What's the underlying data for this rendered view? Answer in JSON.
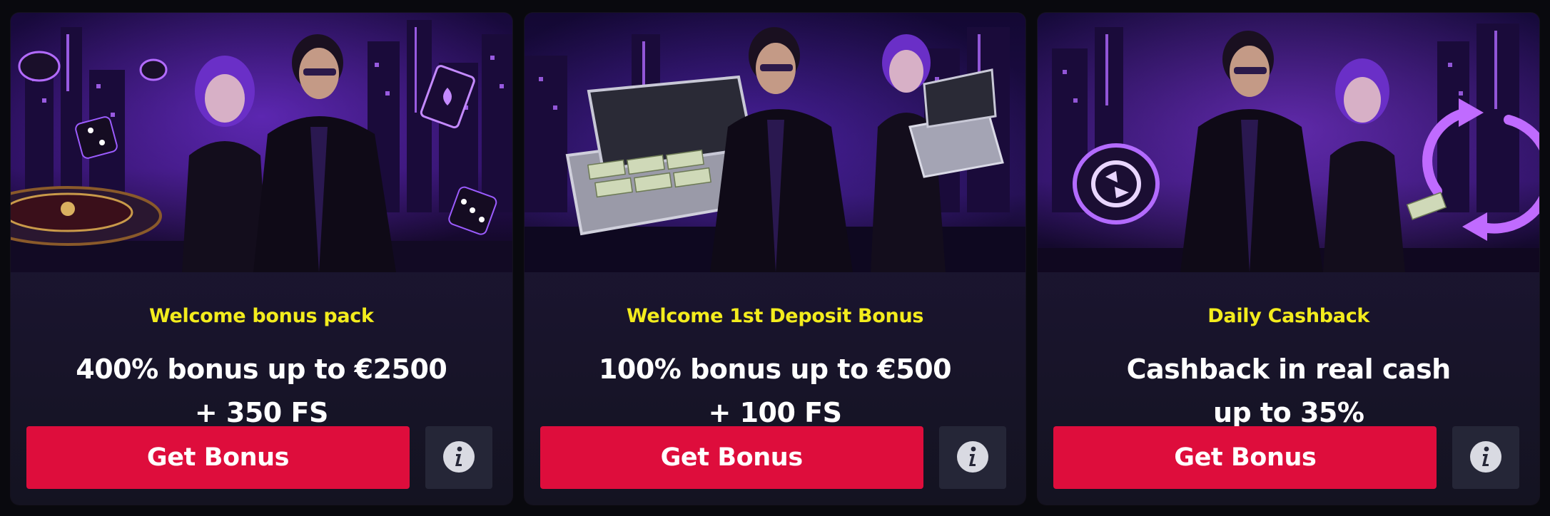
{
  "cards": [
    {
      "title": "Welcome bonus pack",
      "headline": [
        "400% bonus up to €2500",
        "+ 350 FS"
      ],
      "cta_label": "Get Bonus",
      "info_icon": "info-icon",
      "art": "casino-couple-dice-roulette"
    },
    {
      "title": "Welcome 1st Deposit Bonus",
      "headline": [
        "100% bonus up to €500",
        "+ 100 FS"
      ],
      "cta_label": "Get Bonus",
      "info_icon": "info-icon",
      "art": "money-briefcase-couple"
    },
    {
      "title": "Daily Cashback",
      "headline": [
        "Cashback in real cash",
        "up to 35%"
      ],
      "cta_label": "Get Bonus",
      "info_icon": "info-icon",
      "art": "cashback-chip-couple"
    }
  ],
  "colors": {
    "title": "#f3ec1d",
    "cta": "#de0d3c",
    "info_bg": "#252637",
    "card_bg": "#1b1531",
    "page_bg": "#09090e",
    "neon": "#a44cff"
  }
}
